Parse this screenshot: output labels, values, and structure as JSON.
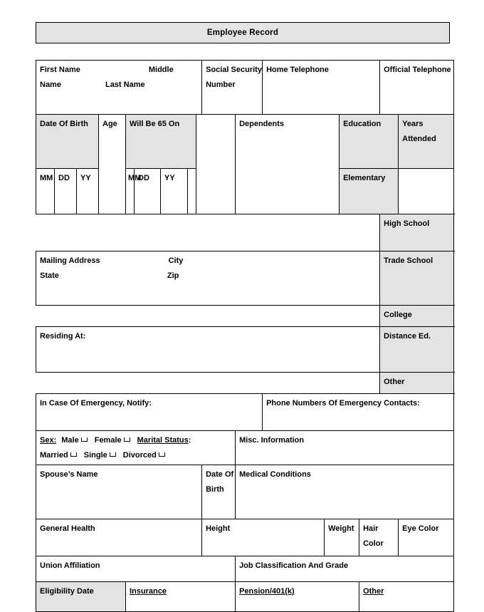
{
  "document": {
    "title": "Employee Record"
  },
  "fields": {
    "first_name": "First Name",
    "middle": "Middle",
    "name": "Name",
    "last_name": "Last Name",
    "ssn": "Social Security Number",
    "home_telephone": "Home Telephone",
    "official_telephone": "Official Telephone",
    "date_of_birth": "Date Of Birth",
    "age": "Age",
    "will_be_65_on": "Will Be 65 On",
    "dependents": "Dependents",
    "mm": "MM",
    "dd": "DD",
    "yy": "YY",
    "mm2": "MM",
    "dd2": "DD",
    "yy2": "YY",
    "mailing_address": "Mailing Address",
    "city": "City",
    "state": "State",
    "zip": "Zip",
    "residing_at": "Residing At:",
    "emergency_notify": "In Case Of Emergency, Notify:",
    "emergency_phones": "Phone Numbers Of Emergency Contacts:",
    "sex_label": "Sex:",
    "male": "Male",
    "female": "Female",
    "marital_status_label": "Marital Status",
    "marital_colon": ":",
    "married": "Married",
    "single": "Single",
    "divorced": "Divorced",
    "misc_information": "Misc. Information",
    "spouse_name": "Spouse’s Name",
    "spouse_dob": "Date Of Birth",
    "medical_conditions": "Medical Conditions",
    "general_health": "General Health",
    "height": "Height",
    "weight": "Weight",
    "hair_color": "Hair Color",
    "eye_color": "Eye Color",
    "union_affiliation": "Union Affiliation",
    "job_classification": "Job Classification And Grade",
    "eligibility_date": "Eligibility Date",
    "insurance": "Insurance",
    "pension": "Pension/401(k)",
    "other_benefit": "Other"
  },
  "education": {
    "header_label": "Education",
    "header_years": "Years Attended",
    "rows": [
      {
        "label": "Elementary",
        "years": ""
      },
      {
        "label": "High School",
        "years": ""
      },
      {
        "label": "Trade School",
        "years": ""
      },
      {
        "label": "College",
        "years": ""
      },
      {
        "label": "Distance Ed.",
        "years": ""
      },
      {
        "label": "Other",
        "years": ""
      }
    ]
  },
  "colors": {
    "shade": "#e3e3e3",
    "border": "#000000",
    "text": "#000000",
    "page": "#ffffff"
  }
}
